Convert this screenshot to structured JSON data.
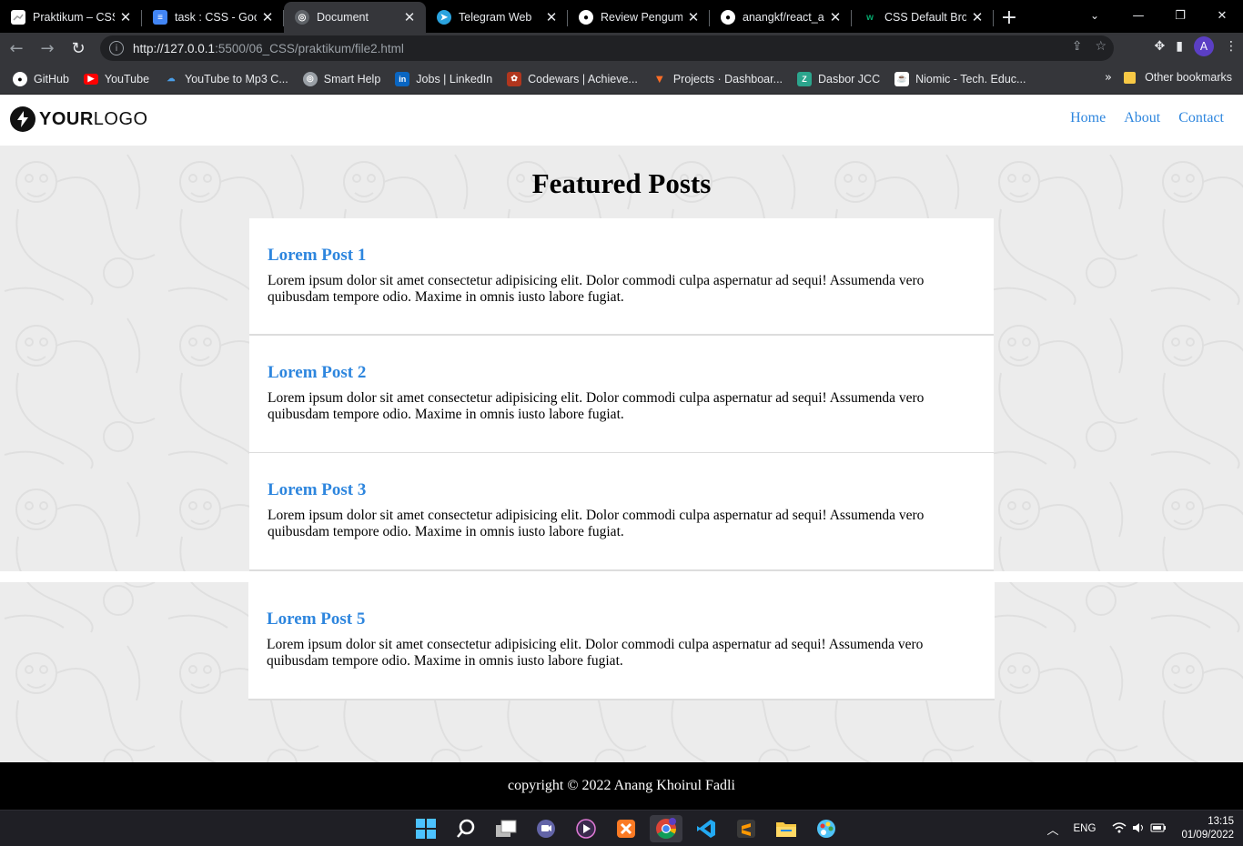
{
  "browser": {
    "tabs": [
      {
        "title": "Praktikum – CSS",
        "icon": "document-icon",
        "active": false
      },
      {
        "title": "task : CSS - Goog",
        "icon": "google-docs-icon",
        "active": false
      },
      {
        "title": "Document",
        "icon": "globe-icon",
        "active": true
      },
      {
        "title": "Telegram Web",
        "icon": "telegram-icon",
        "active": false
      },
      {
        "title": "Review Pengump",
        "icon": "github-icon",
        "active": false
      },
      {
        "title": "anangkf/react_an",
        "icon": "github-icon",
        "active": false
      },
      {
        "title": "CSS Default Brow",
        "icon": "w3schools-icon",
        "active": false
      }
    ],
    "url_host": "http://127.0.0.1",
    "url_path": ":5500/06_CSS/praktikum/file2.html",
    "profile_initial": "A",
    "bookmarks": [
      {
        "label": "GitHub",
        "icon": "github-icon"
      },
      {
        "label": "YouTube",
        "icon": "youtube-icon"
      },
      {
        "label": "YouTube to Mp3 C...",
        "icon": "cloud-download-icon"
      },
      {
        "label": "Smart Help",
        "icon": "globe-icon"
      },
      {
        "label": "Jobs | LinkedIn",
        "icon": "linkedin-icon"
      },
      {
        "label": "Codewars | Achieve...",
        "icon": "codewars-icon"
      },
      {
        "label": "Projects · Dashboar...",
        "icon": "gitlab-icon"
      },
      {
        "label": "Dasbor JCC",
        "icon": "jcc-icon"
      },
      {
        "label": "Niomic - Tech. Educ...",
        "icon": "niomic-icon"
      }
    ],
    "bookmarks_more": "»",
    "other_bookmarks": "Other bookmarks"
  },
  "site": {
    "logo_bold": "YOUR",
    "logo_light": "LOGO",
    "nav": [
      "Home",
      "About",
      "Contact"
    ],
    "heading": "Featured Posts",
    "posts": [
      {
        "title": "Lorem Post 1",
        "body": "Lorem ipsum dolor sit amet consectetur adipisicing elit. Dolor commodi culpa aspernatur ad sequi! Assumenda vero quibusdam tempore odio. Maxime in omnis iusto labore fugiat."
      },
      {
        "title": "Lorem Post 2",
        "body": "Lorem ipsum dolor sit amet consectetur adipisicing elit. Dolor commodi culpa aspernatur ad sequi! Assumenda vero quibusdam tempore odio. Maxime in omnis iusto labore fugiat."
      },
      {
        "title": "Lorem Post 3",
        "body": "Lorem ipsum dolor sit amet consectetur adipisicing elit. Dolor commodi culpa aspernatur ad sequi! Assumenda vero quibusdam tempore odio. Maxime in omnis iusto labore fugiat."
      },
      {
        "title": "Lorem Post 5",
        "body": "Lorem ipsum dolor sit amet consectetur adipisicing elit. Dolor commodi culpa aspernatur ad sequi! Assumenda vero quibusdam tempore odio. Maxime in omnis iusto labore fugiat."
      }
    ],
    "footer": "copyright © 2022 Anang Khoirul Fadli",
    "link_color": "#2e86de"
  },
  "taskbar": {
    "apps": [
      "windows-start-icon",
      "search-icon",
      "task-view-icon",
      "teams-chat-icon",
      "media-player-icon",
      "xampp-icon",
      "chrome-icon",
      "vscode-icon",
      "sublime-text-icon",
      "file-explorer-icon",
      "paint-icon"
    ],
    "language": "ENG",
    "time": "13:15",
    "date": "01/09/2022"
  }
}
